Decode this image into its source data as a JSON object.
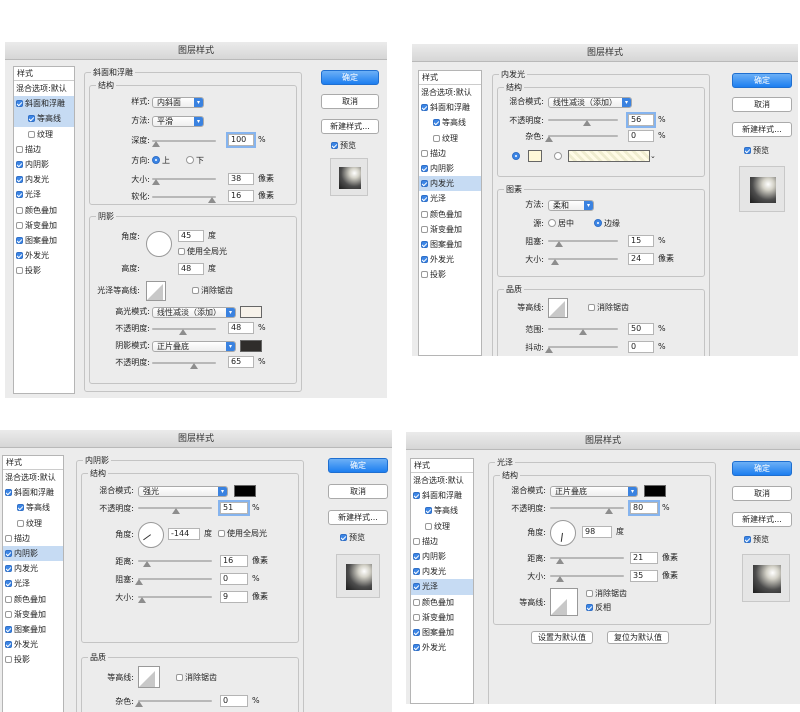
{
  "dialog_title": "图层样式",
  "styles": {
    "header": "样式",
    "blend_options": "混合选项:默认",
    "items": [
      "斜面和浮雕",
      "等高线",
      "纹理",
      "描边",
      "内阴影",
      "内发光",
      "光泽",
      "颜色叠加",
      "渐变叠加",
      "图案叠加",
      "外发光",
      "投影"
    ]
  },
  "buttons": {
    "ok": "确定",
    "cancel": "取消",
    "new_style": "新建样式...",
    "preview": "预览",
    "set_default": "设置为默认值",
    "reset_default": "复位为默认值"
  },
  "p1": {
    "section": "斜面和浮雕",
    "structure": "结构",
    "style_lbl": "样式:",
    "style_val": "内斜面",
    "method_lbl": "方法:",
    "method_val": "平滑",
    "depth_lbl": "深度:",
    "depth_val": "100",
    "pct": "%",
    "dir_lbl": "方向:",
    "dir_up": "上",
    "dir_down": "下",
    "size_lbl": "大小:",
    "size_val": "38",
    "px": "像素",
    "soften_lbl": "软化:",
    "soften_val": "16",
    "shading": "阴影",
    "angle_lbl": "角度:",
    "angle_val": "45",
    "deg": "度",
    "global_light": "使用全局光",
    "alt_lbl": "高度:",
    "alt_val": "48",
    "gloss_lbl": "光泽等高线:",
    "anti_alias": "消除锯齿",
    "hl_mode_lbl": "高光模式:",
    "hl_mode_val": "线性减淡（添加）",
    "hl_op_lbl": "不透明度:",
    "hl_op_val": "48",
    "sh_mode_lbl": "阴影模式:",
    "sh_mode_val": "正片叠底",
    "sh_op_lbl": "不透明度:",
    "sh_op_val": "65",
    "colors": {
      "highlight": "#f7f2ea",
      "shadow": "#2f2d2b"
    }
  },
  "p2": {
    "section": "内发光",
    "structure": "结构",
    "blend_lbl": "混合模式:",
    "blend_val": "线性减淡（添加）",
    "op_lbl": "不透明度:",
    "op_val": "56",
    "pct": "%",
    "noise_lbl": "杂色:",
    "noise_val": "0",
    "elements": "图素",
    "tech_lbl": "方法:",
    "tech_val": "柔和",
    "src_lbl": "源:",
    "src_center": "居中",
    "src_edge": "边缘",
    "choke_lbl": "阻塞:",
    "choke_val": "15",
    "size_lbl": "大小:",
    "size_val": "24",
    "px": "像素",
    "quality": "品质",
    "contour_lbl": "等高线:",
    "anti_alias": "消除锯齿",
    "range_lbl": "范围:",
    "range_val": "50",
    "jitter_lbl": "抖动:",
    "jitter_val": "0",
    "colors": {
      "glow": "#fff8d8"
    }
  },
  "p3": {
    "section": "内阴影",
    "structure": "结构",
    "blend_lbl": "混合模式:",
    "blend_val": "强光",
    "op_lbl": "不透明度:",
    "op_val": "51",
    "pct": "%",
    "angle_lbl": "角度:",
    "angle_val": "-144",
    "deg": "度",
    "global_light": "使用全局光",
    "dist_lbl": "距离:",
    "dist_val": "16",
    "px": "像素",
    "choke_lbl": "阻塞:",
    "choke_val": "0",
    "size_lbl": "大小:",
    "size_val": "9",
    "quality": "品质",
    "contour_lbl": "等高线:",
    "anti_alias": "消除锯齿",
    "noise_lbl": "杂色:",
    "noise_val": "0",
    "colors": {
      "shadow": "#000000"
    }
  },
  "p4": {
    "section": "光泽",
    "structure": "结构",
    "blend_lbl": "混合模式:",
    "blend_val": "正片叠底",
    "op_lbl": "不透明度:",
    "op_val": "80",
    "pct": "%",
    "angle_lbl": "角度:",
    "angle_val": "98",
    "deg": "度",
    "dist_lbl": "距离:",
    "dist_val": "21",
    "px": "像素",
    "size_lbl": "大小:",
    "size_val": "35",
    "contour_lbl": "等高线:",
    "anti_alias": "消除锯齿",
    "invert": "反相",
    "colors": {
      "satin": "#000000"
    }
  }
}
